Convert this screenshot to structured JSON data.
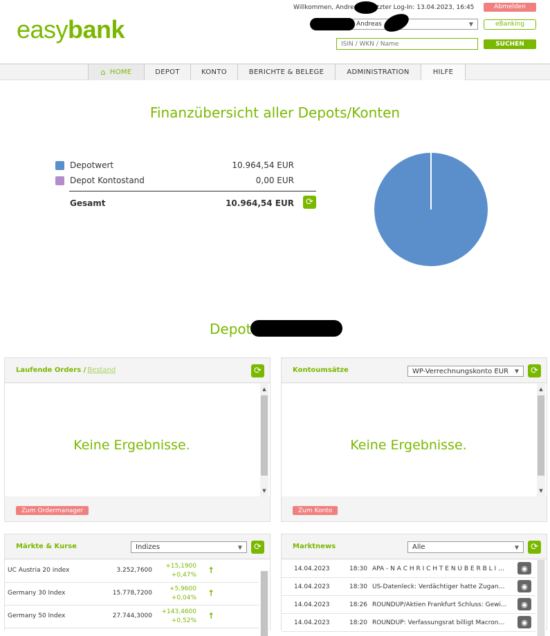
{
  "header": {
    "logo_light": "easy",
    "logo_bold": "bank",
    "welcome": "Willkommen, Andreas",
    "welcome_suffix": "r | Letzter Log-In: 13.04.2023, 16:45",
    "logout_label": "Abmelden",
    "account_select": "Andreas",
    "ebanking_label": "eBanking",
    "search_placeholder": "ISIN / WKN / Name",
    "search_button": "SUCHEN"
  },
  "nav": {
    "items": [
      "HOME",
      "DEPOT",
      "KONTO",
      "BERICHTE & BELEGE",
      "ADMINISTRATION",
      "HILFE"
    ],
    "active": "HOME"
  },
  "overview": {
    "title": "Finanzübersicht aller Depots/Konten",
    "rows": [
      {
        "label": "Depotwert",
        "value": "10.964,54 EUR",
        "color": "#5b8fcc"
      },
      {
        "label": "Depot Kontostand",
        "value": "0,00 EUR",
        "color": "#b48ccc"
      }
    ],
    "total_label": "Gesamt",
    "total_value": "10.964,54 EUR"
  },
  "chart_data": {
    "type": "pie",
    "labels": [
      "Depotwert",
      "Depot Kontostand"
    ],
    "values": [
      10964.54,
      0.0
    ],
    "colors": [
      "#5b8fcc",
      "#b48ccc"
    ]
  },
  "depot": {
    "title": "Depot"
  },
  "orders_panel": {
    "title": "Laufende Orders / ",
    "link": "Bestand",
    "empty": "Keine Ergebnisse.",
    "button": "Zum Ordermanager"
  },
  "account_panel": {
    "title": "Kontoumsätze",
    "select": "WP-Verrechnungskonto EUR",
    "empty": "Keine Ergebnisse.",
    "button": "Zum Konto"
  },
  "markets_panel": {
    "title": "Märkte & Kurse",
    "select": "Indizes",
    "rows": [
      {
        "name": "UC Austria 20 index",
        "price": "3.252,7600",
        "abs": "+15,1900",
        "pct": "+0,47%"
      },
      {
        "name": "Germany 30 Index",
        "price": "15.778,7200",
        "abs": "+5,9600",
        "pct": "+0,04%"
      },
      {
        "name": "Germany 50 Index",
        "price": "27.744,3000",
        "abs": "+143,4600",
        "pct": "+0,52%"
      }
    ]
  },
  "news_panel": {
    "title": "Marktnews",
    "select": "Alle",
    "rows": [
      {
        "date": "14.04.2023",
        "time": "18:30",
        "headline": "APA - N A C H R I C H T E N Ü B E R B L I C K"
      },
      {
        "date": "14.04.2023",
        "time": "18:30",
        "headline": "US-Datenleck: Verdächtiger hatte Zugang z..."
      },
      {
        "date": "14.04.2023",
        "time": "18:26",
        "headline": "ROUNDUP/Aktien Frankfurt Schluss: Gewi..."
      },
      {
        "date": "14.04.2023",
        "time": "18:20",
        "headline": "ROUNDUP: Verfassungsrat billigt Macrons ..."
      }
    ]
  }
}
